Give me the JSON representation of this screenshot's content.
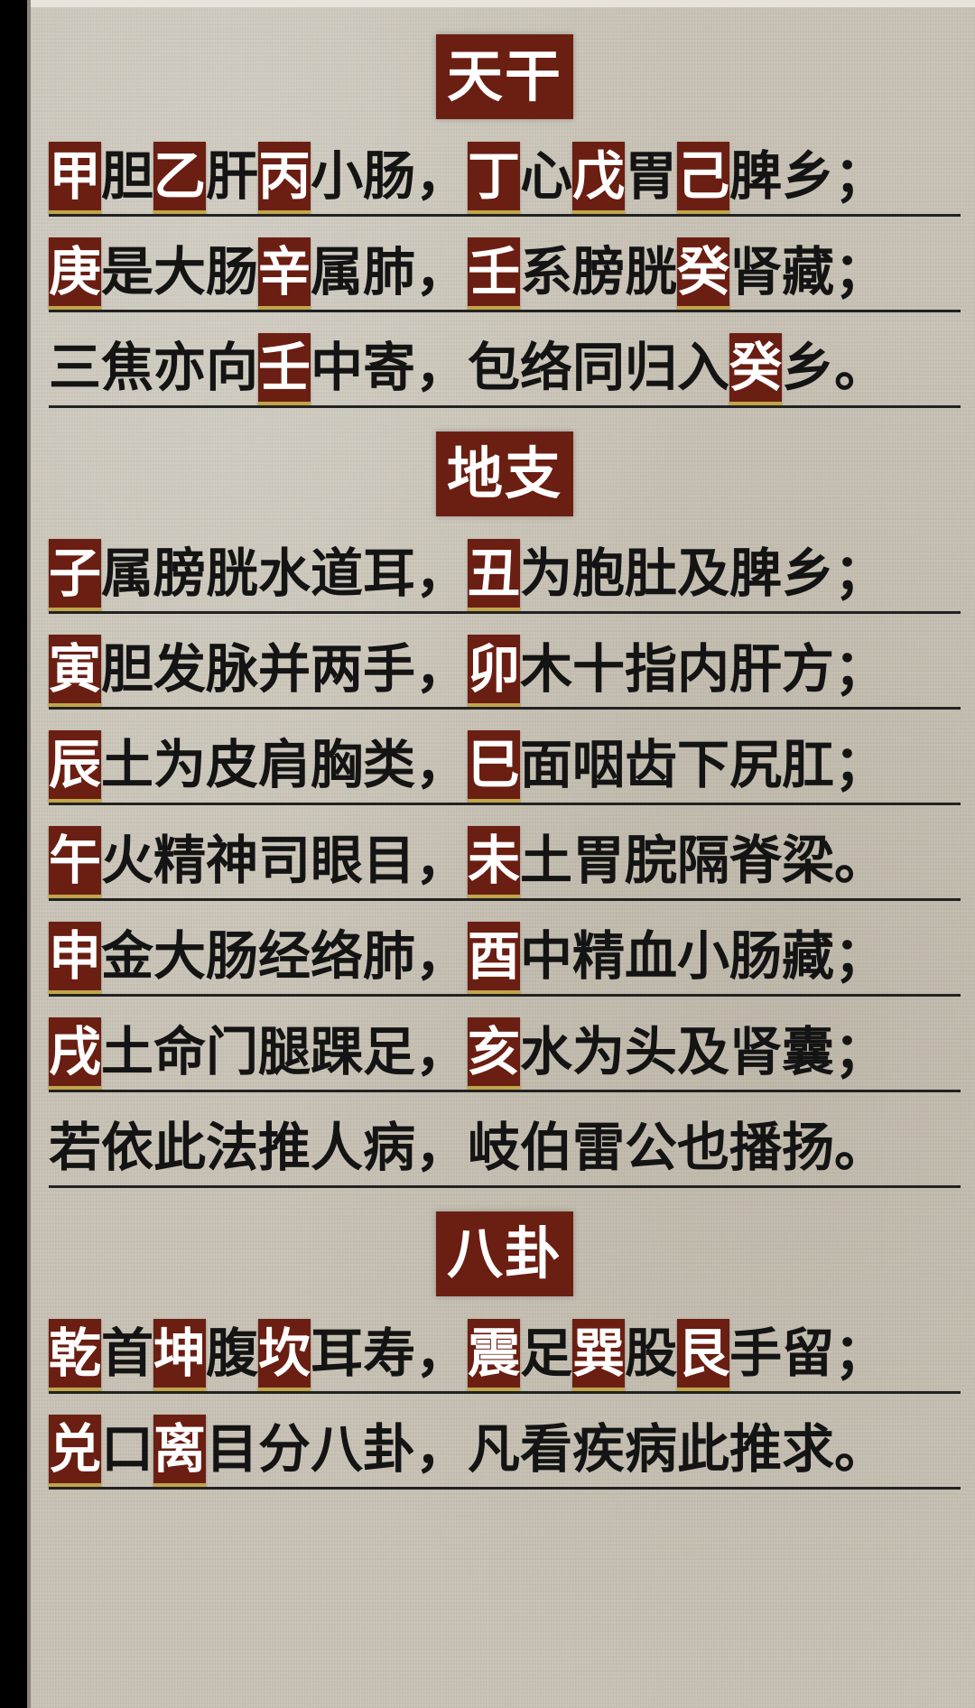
{
  "sections": [
    {
      "title": "天干",
      "lines": [
        [
          [
            "甲",
            true
          ],
          [
            "胆",
            false
          ],
          [
            "乙",
            true
          ],
          [
            "肝",
            false
          ],
          [
            "丙",
            true
          ],
          [
            "小肠，",
            false
          ],
          [
            "丁",
            true
          ],
          [
            "心",
            false
          ],
          [
            "戊",
            true
          ],
          [
            "胃",
            false
          ],
          [
            "己",
            true
          ],
          [
            "脾乡；",
            false
          ]
        ],
        [
          [
            "庚",
            true
          ],
          [
            "是大肠",
            false
          ],
          [
            "辛",
            true
          ],
          [
            "属肺，",
            false
          ],
          [
            "壬",
            true
          ],
          [
            "系膀胱",
            false
          ],
          [
            "癸",
            true
          ],
          [
            "肾藏；",
            false
          ]
        ],
        [
          [
            "三焦亦向",
            false
          ],
          [
            "壬",
            true
          ],
          [
            "中寄，包络同归入",
            false
          ],
          [
            "癸",
            true
          ],
          [
            "乡。",
            false
          ]
        ]
      ]
    },
    {
      "title": "地支",
      "lines": [
        [
          [
            "子",
            true
          ],
          [
            "属膀胱水道耳，",
            false
          ],
          [
            "丑",
            true
          ],
          [
            "为胞肚及脾乡；",
            false
          ]
        ],
        [
          [
            "寅",
            true
          ],
          [
            "胆发脉并两手，",
            false
          ],
          [
            "卯",
            true
          ],
          [
            "木十指内肝方；",
            false
          ]
        ],
        [
          [
            "辰",
            true
          ],
          [
            "土为皮肩胸类，",
            false
          ],
          [
            "巳",
            true
          ],
          [
            "面咽齿下尻肛；",
            false
          ]
        ],
        [
          [
            "午",
            true
          ],
          [
            "火精神司眼目，",
            false
          ],
          [
            "未",
            true
          ],
          [
            "土胃脘隔脊梁。",
            false
          ]
        ],
        [
          [
            "申",
            true
          ],
          [
            "金大肠经络肺，",
            false
          ],
          [
            "酉",
            true
          ],
          [
            "中精血小肠藏；",
            false
          ]
        ],
        [
          [
            "戌",
            true
          ],
          [
            "土命门腿踝足，",
            false
          ],
          [
            "亥",
            true
          ],
          [
            "水为头及肾囊；",
            false
          ]
        ],
        [
          [
            "若依此法推人病，岐伯雷公也播扬。",
            false
          ]
        ]
      ]
    },
    {
      "title": "八卦",
      "lines": [
        [
          [
            "乾",
            true
          ],
          [
            "首",
            false
          ],
          [
            "坤",
            true
          ],
          [
            "腹",
            false
          ],
          [
            "坎",
            true
          ],
          [
            "耳寿，",
            false
          ],
          [
            "震",
            true
          ],
          [
            "足",
            false
          ],
          [
            "巽",
            true
          ],
          [
            "股",
            false
          ],
          [
            "艮",
            true
          ],
          [
            "手留；",
            false
          ]
        ],
        [
          [
            "兑",
            true
          ],
          [
            "口",
            false
          ],
          [
            "离",
            true
          ],
          [
            "目分八卦，凡看疾病此推求。",
            false
          ]
        ]
      ]
    }
  ],
  "colors": {
    "paper": "#c9c3b6",
    "highlight_bg": "#6b1e12",
    "highlight_text": "#ffffff",
    "highlight_edge": "#c0a54a",
    "text": "#141414"
  }
}
